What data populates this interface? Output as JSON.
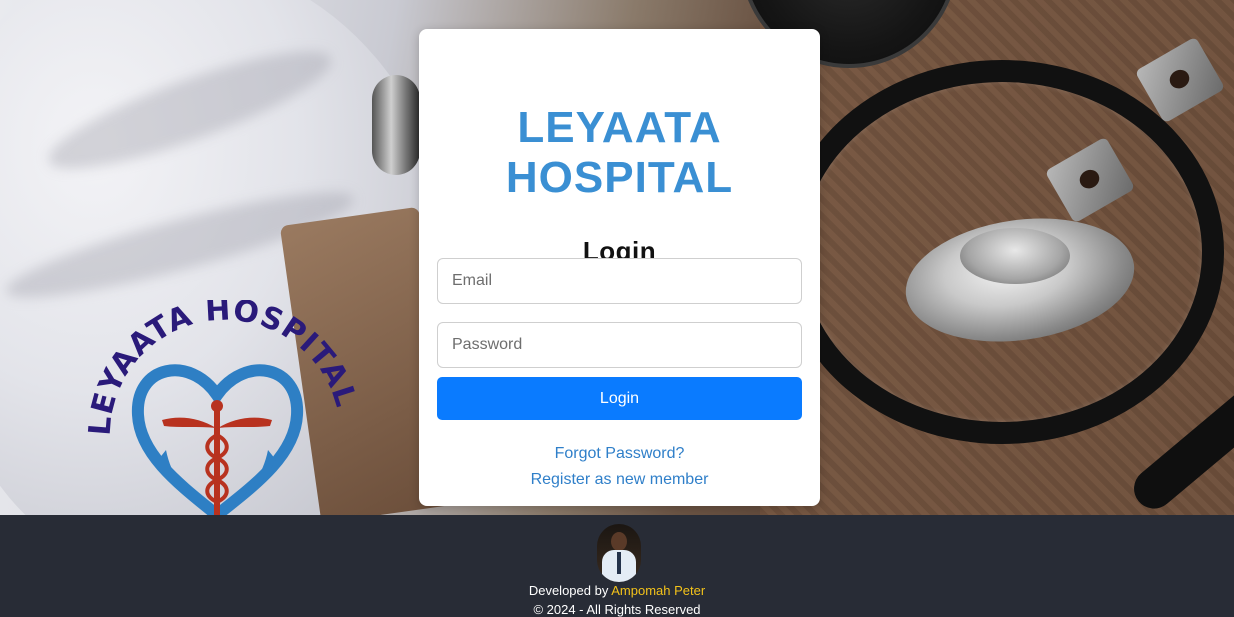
{
  "card": {
    "brand": "LEYAATA HOSPITAL",
    "title": "Login",
    "email_placeholder": "Email",
    "password_placeholder": "Password",
    "login_button": "Login",
    "forgot_link": "Forgot Password?",
    "register_link": "Register as new member"
  },
  "logo": {
    "text": "LEYAATA HOSPITAL"
  },
  "footer": {
    "developed_by": "Developed by",
    "developer_name": "Ampomah Peter",
    "copyright": "© 2024 - All Rights Reserved"
  },
  "colors": {
    "brand_blue": "#3a8fd3",
    "button_blue": "#0a7bff",
    "link_blue": "#2f7fc9",
    "footer_bg": "#282c36",
    "developer_name": "#f3c21a",
    "logo_text": "#2a1a7a",
    "logo_heart": "#2e7fc4",
    "logo_caduceus": "#b8321f"
  },
  "icons": {
    "avatar": "developer-avatar",
    "logo": "heart-hands-caduceus-logo"
  }
}
